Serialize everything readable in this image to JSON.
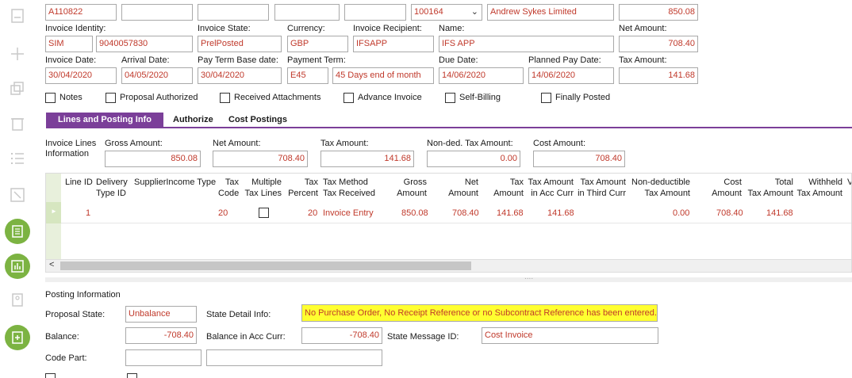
{
  "top_row": {
    "invoice_id": "A110822",
    "supplier_id": "100164",
    "supplier_name": "Andrew Sykes Limited",
    "amount": "850.08"
  },
  "labels": {
    "invoice_identity": "Invoice Identity:",
    "invoice_state": "Invoice State:",
    "currency": "Currency:",
    "invoice_recipient": "Invoice Recipient:",
    "name": "Name:",
    "net_amount": "Net Amount:",
    "invoice_date": "Invoice Date:",
    "arrival_date": "Arrival Date:",
    "pay_term_base_date": "Pay Term Base date:",
    "payment_term": "Payment Term:",
    "due_date": "Due Date:",
    "planned_pay_date": "Planned Pay Date:",
    "tax_amount": "Tax Amount:"
  },
  "values": {
    "series": "SIM",
    "invoice_no": "9040057830",
    "invoice_state": "PrelPosted",
    "currency": "GBP",
    "invoice_recipient": "IFSAPP",
    "name": "IFS APP",
    "net_amount": "708.40",
    "invoice_date": "30/04/2020",
    "arrival_date": "04/05/2020",
    "pay_term_base_date": "30/04/2020",
    "payment_term_code": "E45",
    "payment_term_desc": "45 Days end of month",
    "due_date": "14/06/2020",
    "planned_pay_date": "14/06/2020",
    "tax_amount": "141.68"
  },
  "checkboxes": {
    "notes": "Notes",
    "proposal_authorized": "Proposal Authorized",
    "received_attachments": "Received Attachments",
    "advance_invoice": "Advance Invoice",
    "self_billing": "Self-Billing",
    "finally_posted": "Finally Posted"
  },
  "tabs": {
    "lines_posting": "Lines and Posting Info",
    "authorize": "Authorize",
    "cost_postings": "Cost Postings"
  },
  "lines_info": {
    "title_1": "Invoice Lines",
    "title_2": "Information",
    "gross_label": "Gross Amount:",
    "gross_value": "850.08",
    "net_label": "Net Amount:",
    "net_value": "708.40",
    "tax_label": "Tax Amount:",
    "tax_value": "141.68",
    "nonded_label": "Non-ded. Tax Amount:",
    "nonded_value": "0.00",
    "cost_label": "Cost Amount:",
    "cost_value": "708.40"
  },
  "grid": {
    "headers": {
      "line_id": "Line ID",
      "delivery_type_1": "Delivery",
      "delivery_type_2": "Type ID",
      "supplier_income_type": "SupplierIncome Type",
      "tax_code_1": "Tax",
      "tax_code_2": "Code",
      "multiple_tax_1": "Multiple",
      "multiple_tax_2": "Tax Lines",
      "tax_percent_1": "Tax",
      "tax_percent_2": "Percent",
      "tax_method_1": "Tax Method",
      "tax_method_2": "Tax Received",
      "gross_1": "Gross",
      "gross_2": "Amount",
      "net_1": "Net",
      "net_2": "Amount",
      "tax_1": "Tax",
      "tax_2": "Amount",
      "tax_acc_1": "Tax Amount",
      "tax_acc_2": "in Acc Curr",
      "tax_third_1": "Tax Amount",
      "tax_third_2": "in Third Curr",
      "nonded_1": "Non-deductible",
      "nonded_2": "Tax Amount",
      "cost_1": "Cost",
      "cost_2": "Amount",
      "total_1": "Total",
      "total_2": "Tax Amount",
      "withheld_1": "Withheld",
      "withheld_2": "Tax Amount",
      "more": "V"
    },
    "row": {
      "line_id": "1",
      "tax_code": "20",
      "tax_percent": "20",
      "tax_method": "Invoice Entry",
      "gross": "850.08",
      "net": "708.40",
      "tax": "141.68",
      "tax_acc": "141.68",
      "nonded": "0.00",
      "cost": "708.40",
      "total_tax": "141.68"
    },
    "scroll_left": "<",
    "splitter": "...."
  },
  "posting": {
    "section_title": "Posting Information",
    "proposal_state_label": "Proposal State:",
    "proposal_state_value": "Unbalance",
    "state_detail_label": "State Detail Info:",
    "state_detail_value": "No Purchase Order, No Receipt Reference or no Subcontract Reference has been entered.",
    "balance_label": "Balance:",
    "balance_value": "-708.40",
    "balance_acc_label": "Balance in Acc Curr:",
    "balance_acc_value": "-708.40",
    "state_message_label": "State Message ID:",
    "state_message_value": "Cost Invoice",
    "code_part_label": "Code Part:"
  },
  "colors": {
    "accent": "#7b3f99",
    "value_text": "#c0392b",
    "action_green": "#7cb342",
    "highlight": "#ffff30"
  }
}
